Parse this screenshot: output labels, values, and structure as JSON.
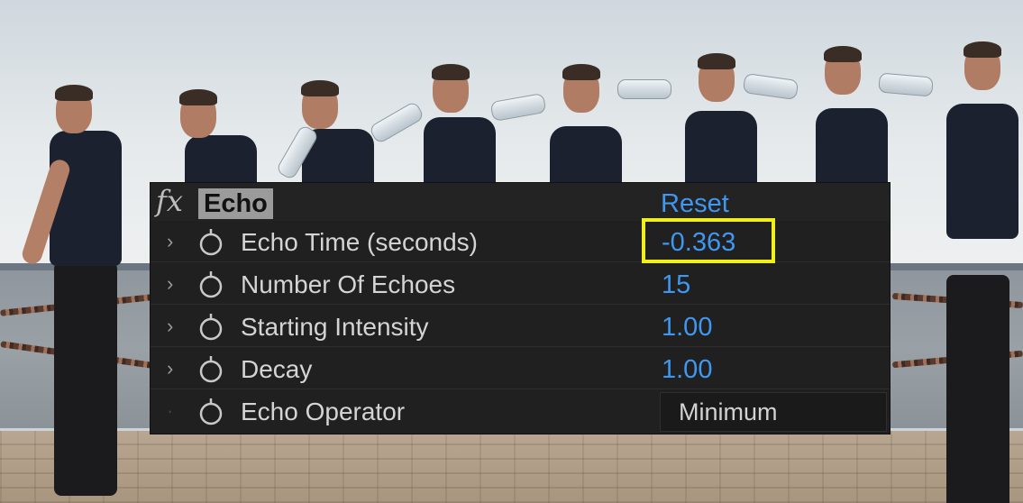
{
  "effect": {
    "fx_icon_label": "fx",
    "name": "Echo",
    "reset_label": "Reset"
  },
  "properties": [
    {
      "label": "Echo Time (seconds)",
      "value": "-0.363",
      "highlighted": true,
      "twirl": "›"
    },
    {
      "label": "Number Of Echoes",
      "value": "15",
      "twirl": "›"
    },
    {
      "label": "Starting Intensity",
      "value": "1.00",
      "twirl": "›"
    },
    {
      "label": "Decay",
      "value": "1.00",
      "twirl": "›"
    },
    {
      "label": "Echo Operator",
      "value": "Minimum",
      "twirl": "·",
      "control": "dropdown"
    }
  ],
  "icons": {
    "twirl": "chevron-right-icon",
    "stopwatch": "stopwatch-icon",
    "fx": "fx-icon"
  },
  "colors": {
    "panel_bg": "#202020",
    "value_blue": "#3f97f0",
    "highlight_yellow": "#f2ee17",
    "effect_name_bg": "#9b9b9b"
  }
}
